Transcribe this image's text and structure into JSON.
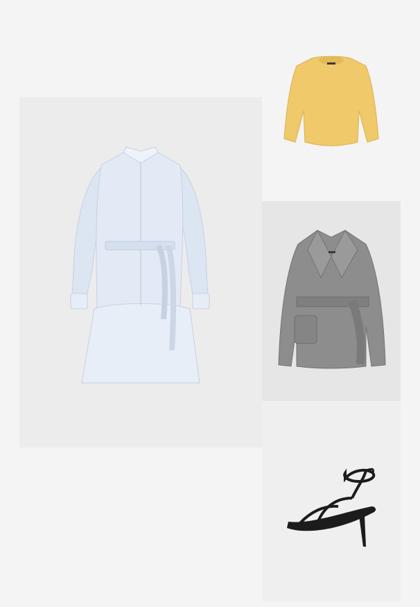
{
  "items": [
    {
      "id": "dress",
      "name": "shirt-dress",
      "color": "#dde6f3"
    },
    {
      "id": "sweater",
      "name": "knit-sweater",
      "color": "#efc96a"
    },
    {
      "id": "coat",
      "name": "wool-coat",
      "color": "#8c8c8c"
    },
    {
      "id": "sandal",
      "name": "strappy-sandal",
      "color": "#1c1c1c"
    }
  ],
  "colors": {
    "page_background": "#f4f4f4"
  }
}
